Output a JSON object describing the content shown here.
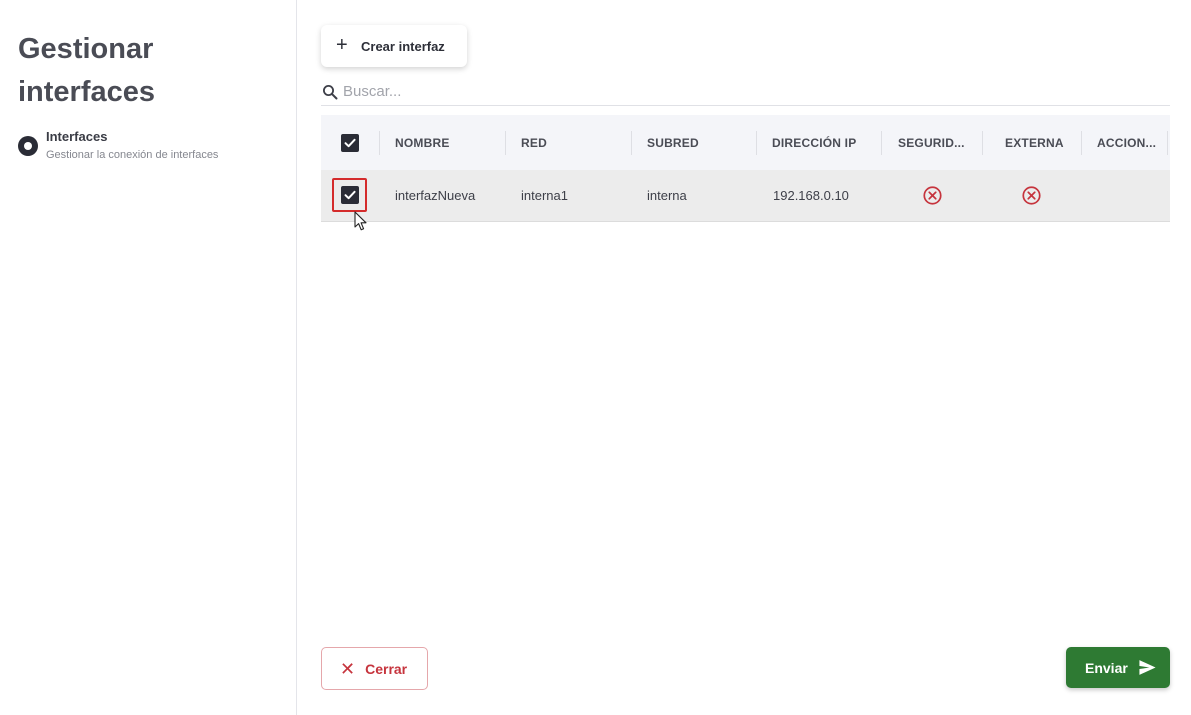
{
  "sidebar": {
    "title_line1": "Gestionar",
    "title_line2": "interfaces",
    "step": {
      "title": "Interfaces",
      "subtitle": "Gestionar la conexión de interfaces",
      "icon": "step-active-dot-icon"
    }
  },
  "toolbar": {
    "create_icon": "+",
    "create_label": "Crear interfaz"
  },
  "search": {
    "placeholder": "Buscar...",
    "value": ""
  },
  "table": {
    "headers": [
      "NOMBRE",
      "RED",
      "SUBRED",
      "DIRECCIÓN IP",
      "SEGURID...",
      "EXTERNA",
      "ACCION..."
    ],
    "select_all_checked": true,
    "rows": [
      {
        "checked": true,
        "nombre": "interfazNueva",
        "red": "interna1",
        "subred": "interna",
        "ip": "192.168.0.10",
        "seguridad": "x-circle-icon",
        "externa": "x-circle-icon",
        "acciones": ""
      }
    ]
  },
  "footer": {
    "cancel_icon": "✕",
    "cancel_label": "Cerrar",
    "send_label": "Enviar",
    "send_icon": "send-icon"
  },
  "colors": {
    "accent_dark": "#2a2c36",
    "cancel_red": "#c6343d",
    "send_green": "#2e7a33",
    "highlight_red": "#d42b2b"
  }
}
